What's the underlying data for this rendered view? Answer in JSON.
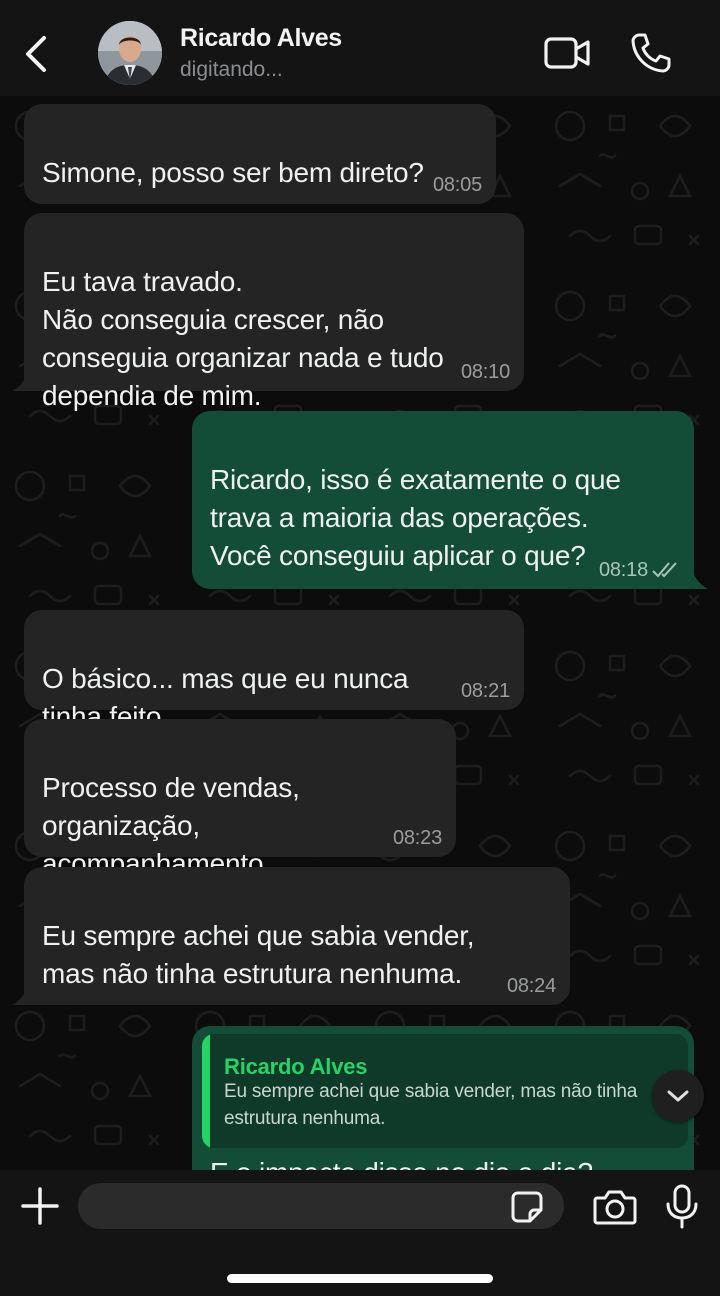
{
  "header": {
    "contact_name": "Ricardo Alves",
    "status": "digitando..."
  },
  "messages": [
    {
      "direction": "in",
      "text": "Simone, posso ser bem direto?",
      "time": "08:05"
    },
    {
      "direction": "in",
      "text": "Eu tava travado.\nNão conseguia crescer, não\nconseguia organizar nada e tudo\ndependia de mim.",
      "time": "08:10"
    },
    {
      "direction": "out",
      "text": "Ricardo, isso é exatamente o que\ntrava a maioria das operações.\nVocê conseguiu aplicar o que?",
      "time": "08:18",
      "status": "read"
    },
    {
      "direction": "in",
      "text": "O básico... mas que eu nunca\ntinha feito.",
      "time": "08:21"
    },
    {
      "direction": "in",
      "text": "Processo de vendas,\norganização,\nacompanhamento...",
      "time": "08:23"
    },
    {
      "direction": "in",
      "text": "Eu sempre achei que sabia vender,\nmas não tinha estrutura nenhuma.",
      "time": "08:24"
    }
  ],
  "reply_message": {
    "quoted_name": "Ricardo Alves",
    "quoted_text": "Eu sempre achei que sabia vender, mas não tinha estrutura nenhuma.",
    "text": "E o impacto disso no dia a dia?"
  },
  "input": {
    "placeholder": "",
    "value": ""
  },
  "colors": {
    "incoming_bubble": "#242424",
    "outgoing_bubble": "#144d37",
    "accent_green": "#25d366",
    "header_bg": "#141414"
  },
  "icons": [
    "back-arrow-icon",
    "video-call-icon",
    "phone-icon",
    "double-check-icon",
    "chevron-down-icon",
    "plus-icon",
    "sticker-icon",
    "camera-icon",
    "microphone-icon"
  ]
}
